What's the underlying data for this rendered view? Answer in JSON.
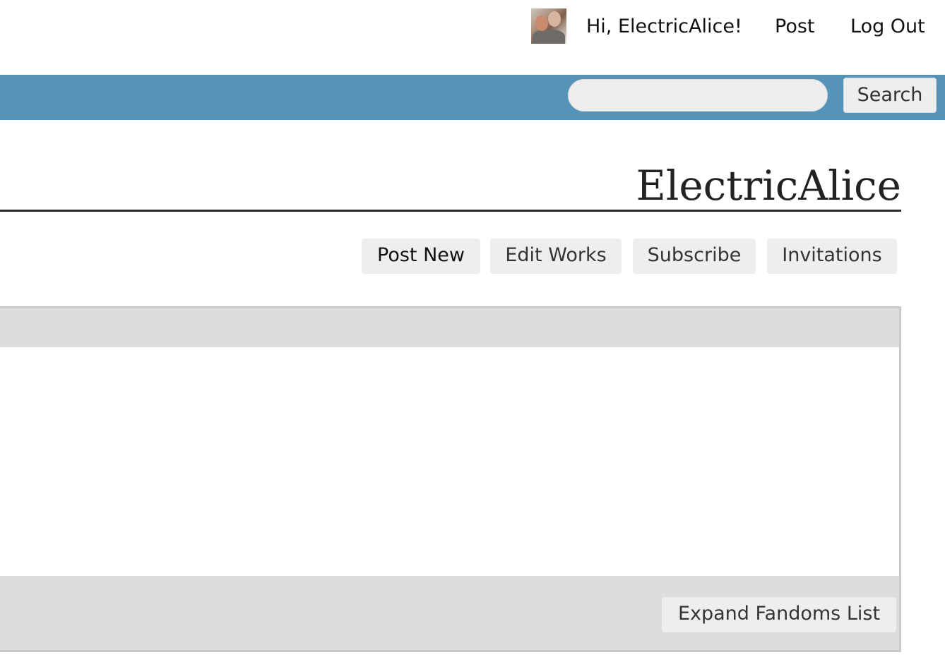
{
  "header": {
    "greeting": "Hi, ElectricAlice!",
    "post_label": "Post",
    "logout_label": "Log Out",
    "avatar_icon": "user-avatar"
  },
  "search": {
    "value": "",
    "placeholder": "",
    "button_label": "Search"
  },
  "profile": {
    "username": "ElectricAlice"
  },
  "actions": {
    "post_new": "Post New",
    "edit_works": "Edit Works",
    "subscribe": "Subscribe",
    "invitations": "Invitations"
  },
  "fandoms_panel": {
    "expand_label": "Expand Fandoms List"
  },
  "colors": {
    "nav_bar": "#5594b8",
    "button_bg": "#eeeeee",
    "panel_bg": "#dddddd"
  }
}
